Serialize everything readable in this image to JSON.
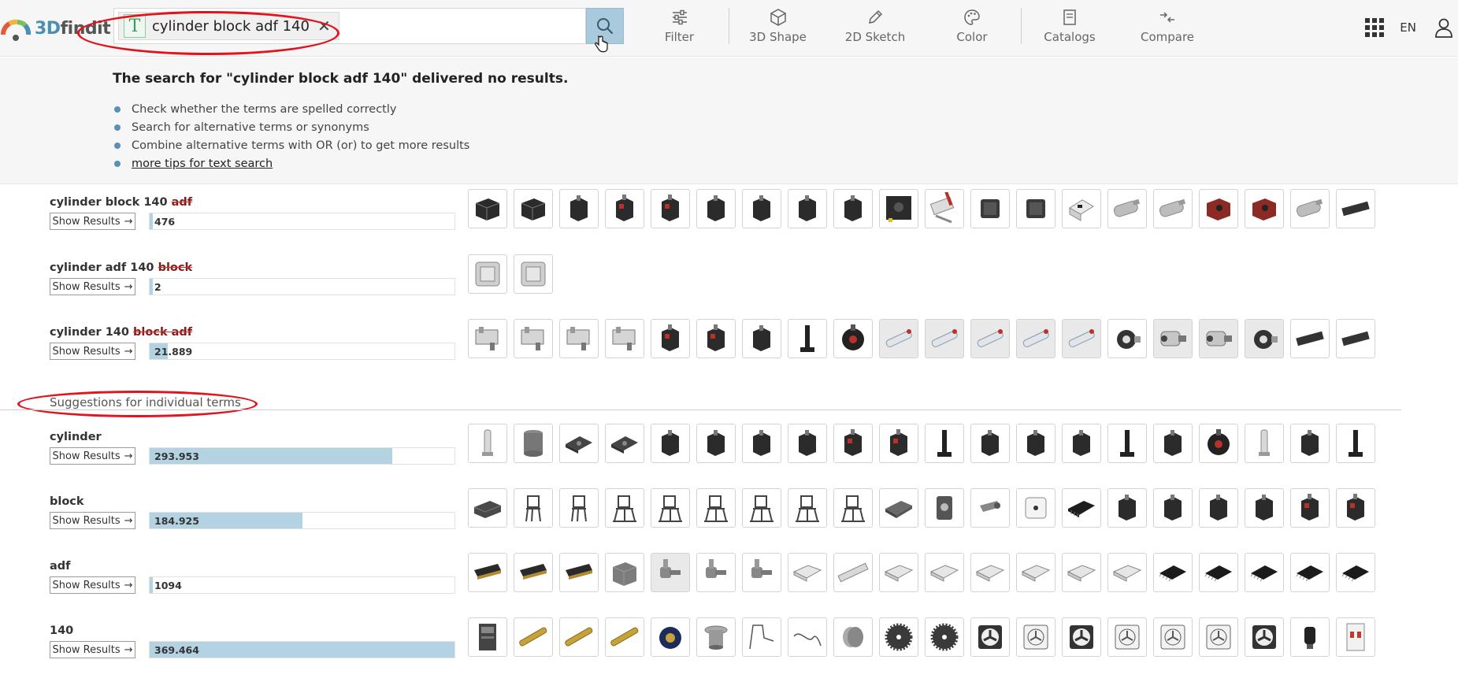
{
  "header": {
    "logo_text_a": "3D",
    "logo_text_b": "findit",
    "search_chip_text": "cylinder block adf 140",
    "nav": [
      {
        "label": "Filter",
        "icon": "sliders-icon"
      },
      {
        "label": "3D Shape",
        "icon": "cube-icon"
      },
      {
        "label": "2D Sketch",
        "icon": "pencil-icon"
      },
      {
        "label": "Color",
        "icon": "palette-icon"
      },
      {
        "label": "Catalogs",
        "icon": "catalog-icon"
      },
      {
        "label": "Compare",
        "icon": "compare-icon"
      }
    ],
    "lang": "EN"
  },
  "no_results": {
    "title": "The search for \"cylinder block adf 140\" delivered no results.",
    "tips": [
      "Check whether the terms are spelled correctly",
      "Search for alternative terms or synonyms",
      "Combine alternative terms with OR (or) to get more results"
    ],
    "more_link": "more tips for text search"
  },
  "show_results_label": "Show Results",
  "combo_rows": [
    {
      "kept": "cylinder block 140 ",
      "struck": "adf",
      "count": "476",
      "fraction": 0.004
    },
    {
      "kept": "cylinder adf 140 ",
      "struck": "block",
      "count": "2",
      "fraction": 0.0
    },
    {
      "kept": "cylinder 140 ",
      "struck": "block adf",
      "count": "21.889",
      "fraction": 0.059
    }
  ],
  "section_title": "Suggestions for individual terms",
  "term_rows": [
    {
      "term": "cylinder",
      "count": "293.953",
      "fraction": 0.796
    },
    {
      "term": "block",
      "count": "184.925",
      "fraction": 0.5
    },
    {
      "term": "adf",
      "count": "1094",
      "fraction": 0.003
    },
    {
      "term": "140",
      "count": "369.464",
      "fraction": 1.0
    }
  ],
  "colors": {
    "accent": "#4a8fb4",
    "bar_fill": "#b3d3e3",
    "annotation_red": "#e3121b",
    "strike_red": "#c0392b"
  }
}
